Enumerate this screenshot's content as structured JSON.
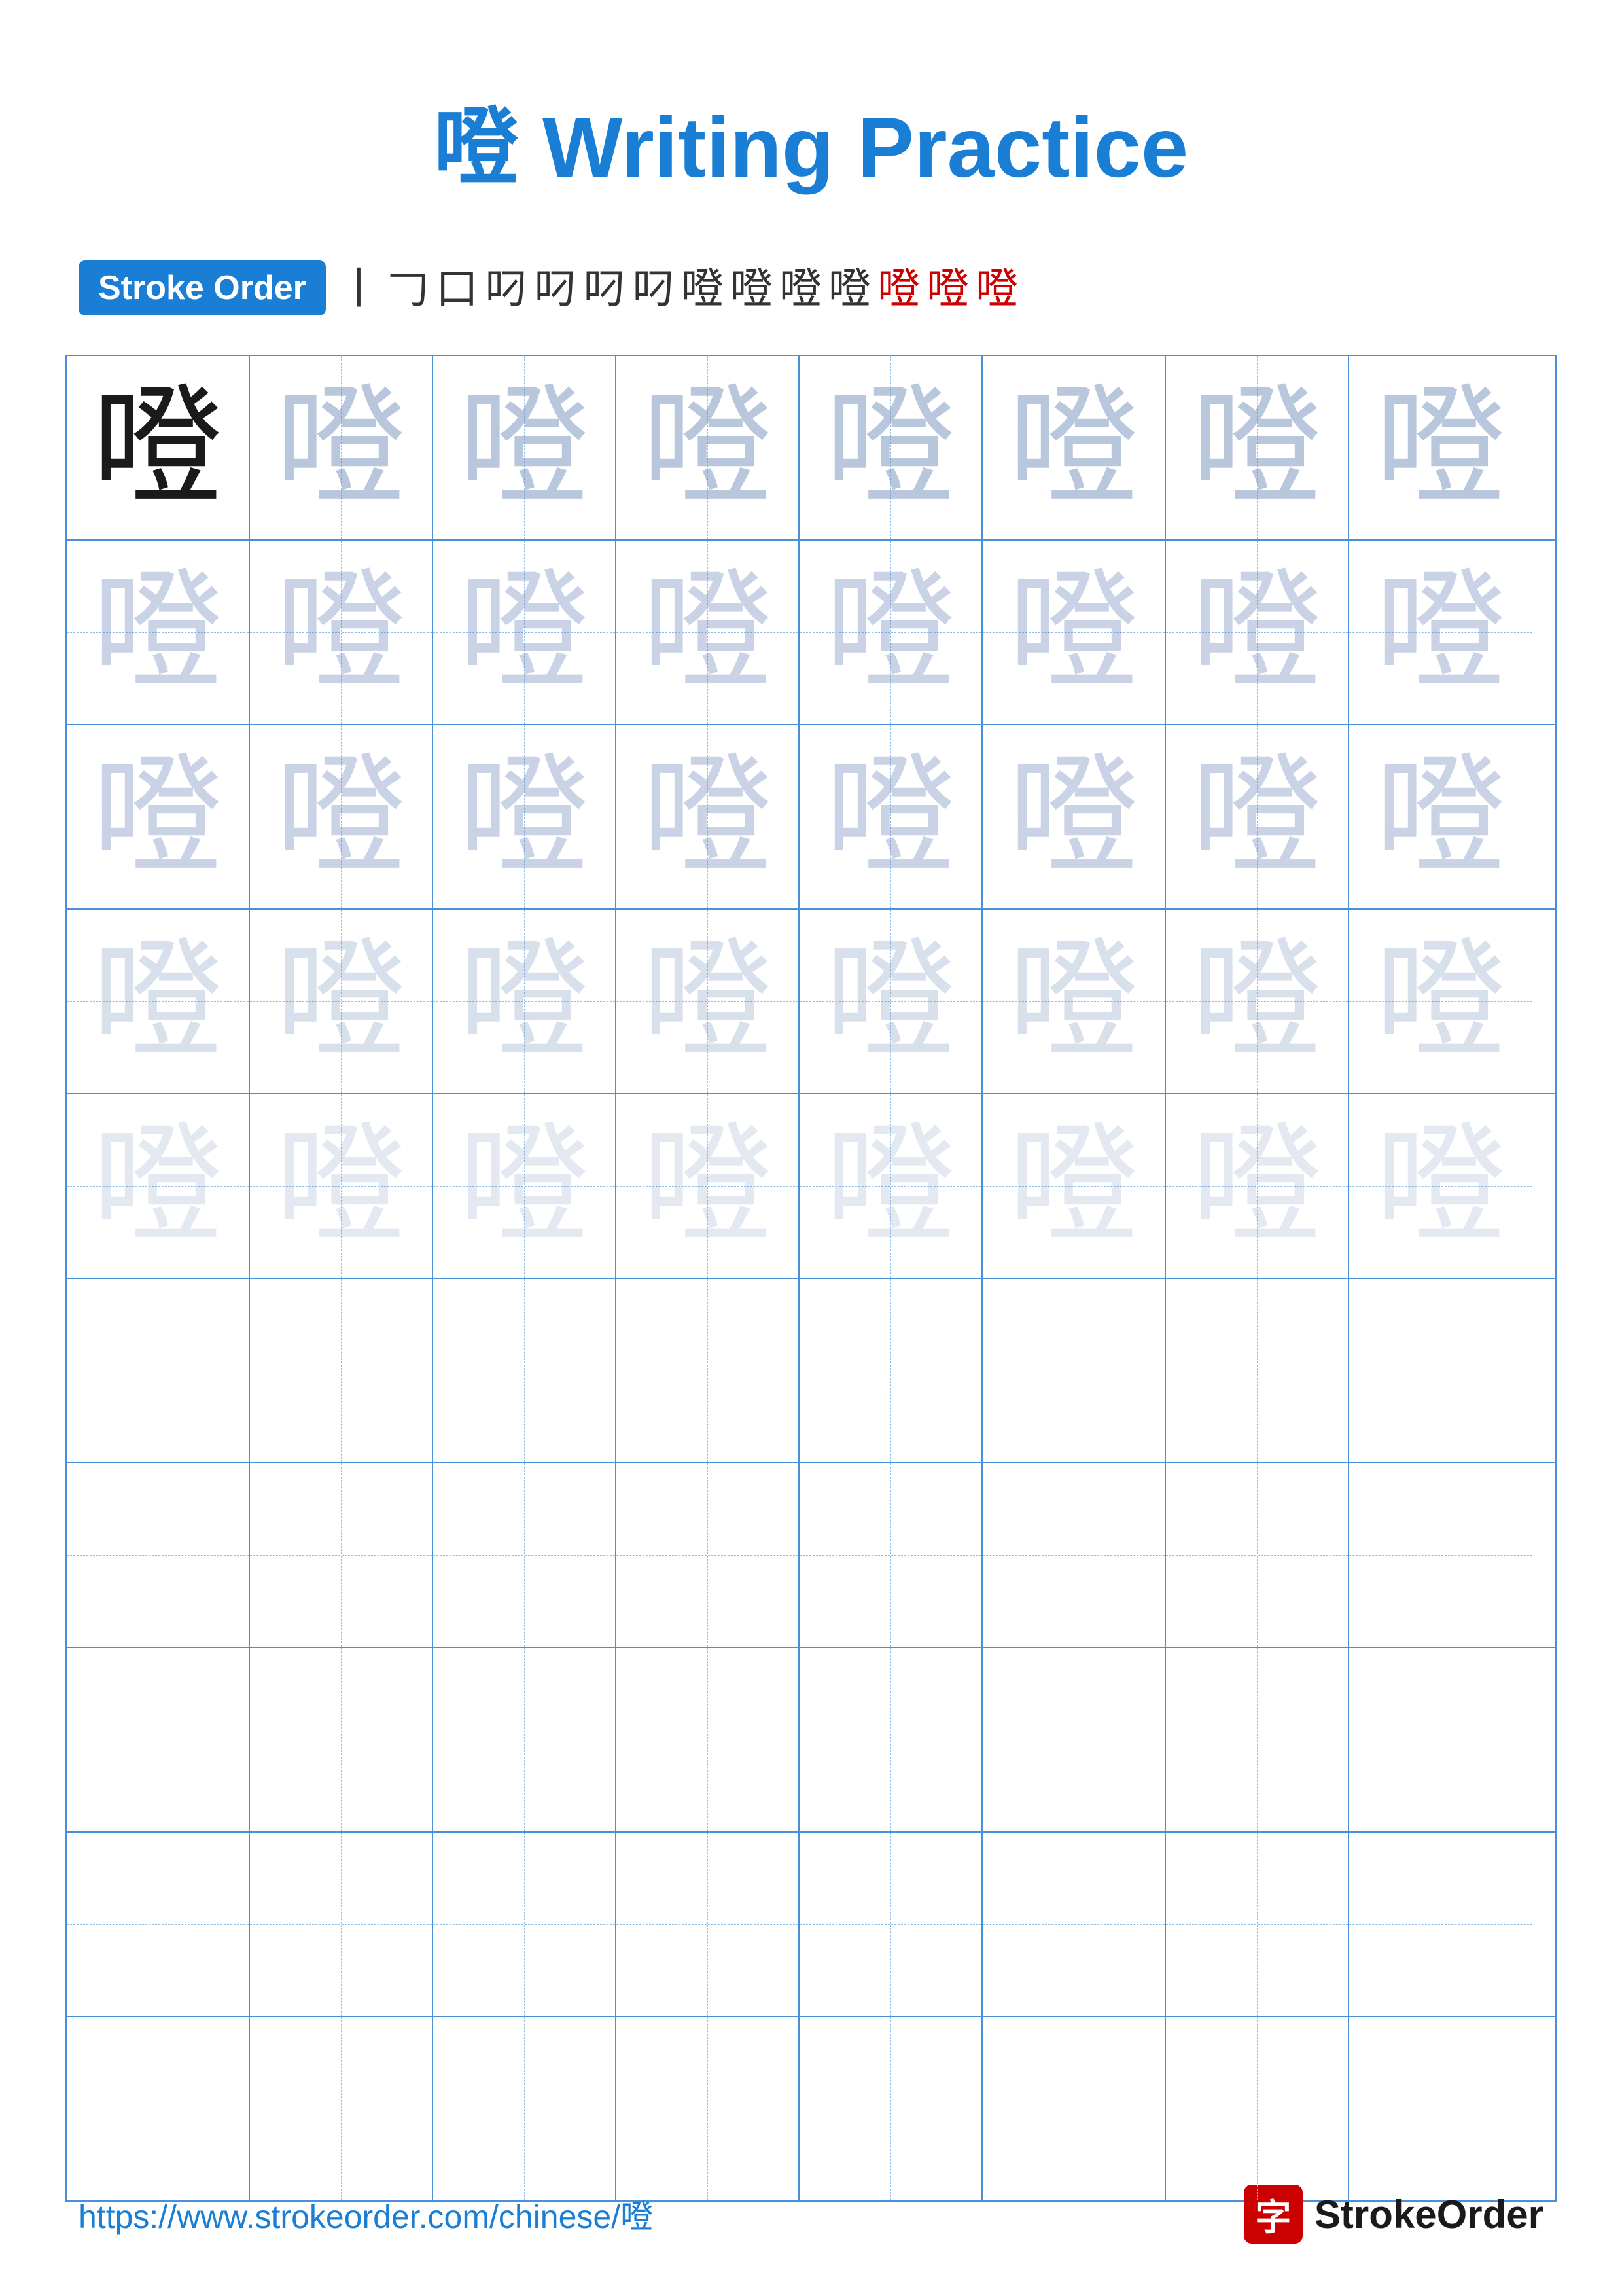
{
  "title": "噔 Writing Practice",
  "stroke_order": {
    "badge_label": "Stroke Order",
    "chars": [
      "丨",
      "⺊",
      "口",
      "叼",
      "叼",
      "叼",
      "叼",
      "叼",
      "噔",
      "噔",
      "噔",
      "噔",
      "噔",
      "噔"
    ]
  },
  "character": "噔",
  "grid": {
    "rows": 10,
    "cols": 8
  },
  "footer": {
    "url": "https://www.strokeorder.com/chinese/噔",
    "brand_icon": "字",
    "brand_name": "StrokeOrder"
  }
}
